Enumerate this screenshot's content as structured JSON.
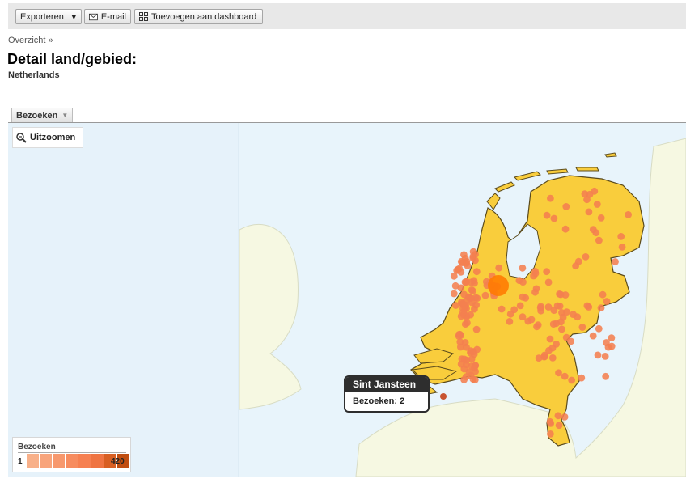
{
  "toolbar": {
    "export_label": "Exporteren",
    "email_label": "E-mail",
    "dashboard_label": "Toevoegen aan dashboard"
  },
  "breadcrumb": "Overzicht »",
  "page": {
    "title": "Detail land/gebied:",
    "subtitle": "Netherlands"
  },
  "metric_selector": {
    "selected": "Bezoeken"
  },
  "map": {
    "zoom_out_label": "Uitzoomen",
    "colors": {
      "water": "#e8f4fb",
      "land_other": "#f6f8e2",
      "country_fill": "#f9cd3c",
      "country_stroke": "#5a4a1c",
      "marker": "#f48050",
      "marker_hot": "#ff7a00",
      "marker_selected": "#c33e14"
    },
    "tooltip": {
      "city": "Sint Jansteen",
      "metric_label": "Bezoeken: 2"
    },
    "legend": {
      "title": "Bezoeken",
      "min": "1",
      "max": "420",
      "ramp": [
        "#f8b089",
        "#f8a47b",
        "#f7986d",
        "#f78c5f",
        "#f68051",
        "#ef7442",
        "#d85f23",
        "#c04d10"
      ]
    }
  }
}
